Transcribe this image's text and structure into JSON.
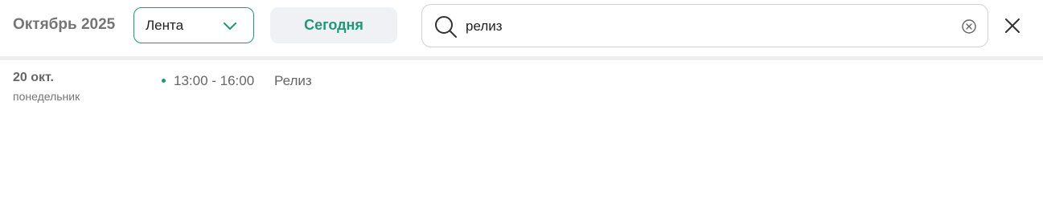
{
  "header": {
    "month_title": "Октябрь 2025",
    "view_select": {
      "value": "Лента"
    },
    "today_label": "Сегодня",
    "search": {
      "value": "релиз",
      "placeholder": ""
    }
  },
  "colors": {
    "accent": "#1e9976",
    "today_bg": "#f0f1f4",
    "muted_text": "#757575"
  },
  "icons": {
    "view_select": "chevron-down-icon",
    "search": "search-icon",
    "clear": "clear-circle-icon",
    "close": "close-icon"
  },
  "results": [
    {
      "date": "20 окт.",
      "weekday": "понедельник",
      "events": [
        {
          "time": "13:00 - 16:00",
          "title": "Релиз"
        }
      ]
    }
  ]
}
